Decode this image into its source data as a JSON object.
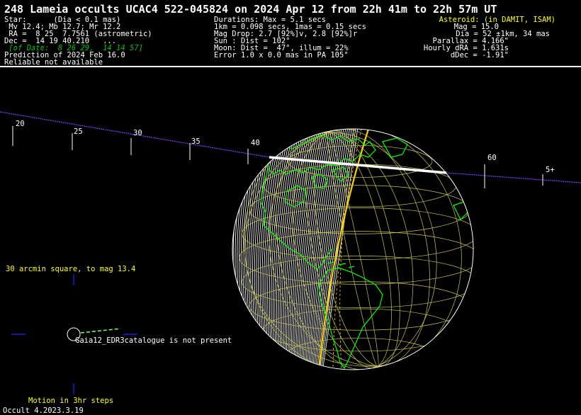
{
  "title": "248 Lameia occults UCAC4 522-045824 on 2024 Apr 12 from 22h 41m to 22h 57m UT",
  "star": {
    "l1": "Star:      (Dia < 0.1 mas)",
    "l2": " Mv 12.4; Mb 12.7; Mr 12.2",
    "l3": " RA =  8 25  7.7561 (astrometric)",
    "l4": "Dec =  14 19 40.210   ...",
    "l5": " [of Date:  8 26 29,  14 14 57]",
    "l6": "Prediction of 2024 Feb 16.0",
    "l7": "Reliable not available"
  },
  "durations": {
    "l1": "Durations: Max = 5.1 secs",
    "l2": "1km = 0.098 secs, 1mas = 0.15 secs",
    "l3": "Mag Drop: 2.7 [92%]v, 2.8 [92%]r",
    "l4": "Sun : Dist = 102°",
    "l5": "Moon: Dist =  47°, illum = 22%",
    "l6": "Error 1.0 x 0.0 mas in PA 105°"
  },
  "asteroid": {
    "l1": "Asteroid: (in DAMIT, ISAM)",
    "l2": "Mag = 15.0",
    "l3": "Dia = 52 ±1km, 34 mas",
    "l4": "Parallax = 4.166\"",
    "l5": "Hourly dRA = 1.631s",
    "l6": "dDec = -1.91\""
  },
  "path_ticks": [
    "20",
    "25",
    "30",
    "35",
    "40",
    "60",
    "5+"
  ],
  "labels": {
    "starfield": "30 arcmin square, to mag 13.4",
    "gaia": "Gaia12_EDR3catalogue is not present",
    "motion": "Motion in 3hr steps",
    "version": "Occult 4.2023.3.19"
  },
  "colors": {
    "background": "#000000",
    "text": "#ffffff",
    "highlight": "#ffff00",
    "italic_green": "#00c000",
    "coastline": "#00ff00",
    "path_line": "#8040ff",
    "finder": "#2020ff",
    "limit_lines": "#ffd000"
  }
}
